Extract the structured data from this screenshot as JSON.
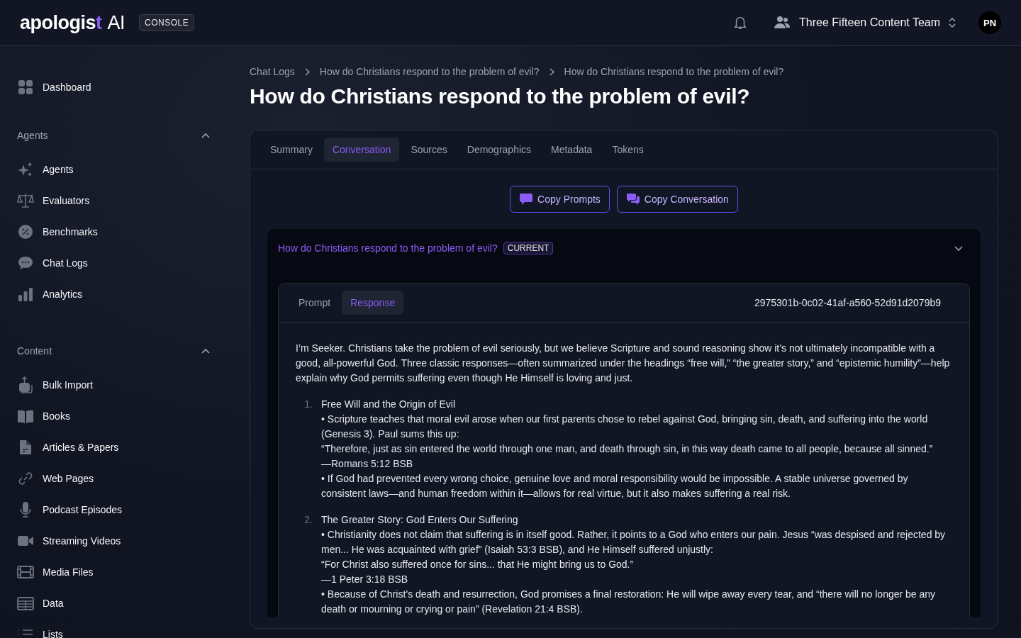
{
  "header": {
    "logo": {
      "word": "apologis",
      "accent": "t",
      "suffix": "AI"
    },
    "badge": "CONSOLE",
    "team": "Three Fifteen Content Team",
    "avatar": "PN"
  },
  "sidebar": {
    "top": [
      {
        "label": "Dashboard",
        "selected": false
      }
    ],
    "sections": [
      {
        "title": "Agents",
        "expanded": true,
        "items": [
          {
            "label": "Agents",
            "selected": false
          },
          {
            "label": "Evaluators",
            "selected": false
          },
          {
            "label": "Benchmarks",
            "selected": false
          },
          {
            "label": "Chat Logs",
            "selected": false
          },
          {
            "label": "Analytics",
            "selected": false
          }
        ]
      },
      {
        "title": "Content",
        "expanded": true,
        "items": [
          {
            "label": "Bulk Import",
            "selected": false
          },
          {
            "label": "Books",
            "selected": false
          },
          {
            "label": "Articles & Papers",
            "selected": false
          },
          {
            "label": "Web Pages",
            "selected": false
          },
          {
            "label": "Podcast Episodes",
            "selected": false
          },
          {
            "label": "Streaming Videos",
            "selected": false
          },
          {
            "label": "Media Files",
            "selected": false
          },
          {
            "label": "Data",
            "selected": false
          },
          {
            "label": "Lists",
            "selected": false
          }
        ]
      }
    ]
  },
  "breadcrumb": [
    "Chat Logs",
    "How do Christians respond to the problem of evil?",
    "How do Christians respond to the problem of evil?"
  ],
  "title": "How do Christians respond to the problem of evil?",
  "tabs": [
    {
      "label": "Summary",
      "selected": false
    },
    {
      "label": "Conversation",
      "selected": true
    },
    {
      "label": "Sources",
      "selected": false
    },
    {
      "label": "Demographics",
      "selected": false
    },
    {
      "label": "Metadata",
      "selected": false
    },
    {
      "label": "Tokens",
      "selected": false
    }
  ],
  "actions": [
    "Copy Prompts",
    "Copy Conversation"
  ],
  "turn": {
    "question": "How do Christians respond to the problem of evil?",
    "badge": "CURRENT",
    "expanded": true,
    "tabs": [
      {
        "label": "Prompt",
        "selected": false
      },
      {
        "label": "Response",
        "selected": true
      }
    ],
    "id": "2975301b-0c02-41af-a560-52d91d2079b9",
    "intro": "I’m Seeker. Christians take the problem of evil seriously, but we believe Scripture and sound reasoning show it’s not ultimately incompatible with a good, all-powerful God. Three classic responses—often summarized under the headings “free will,” “the greater story,” and “epistemic humility”—help explain why God permits suffering even though He Himself is loving and just.",
    "points": [
      {
        "number": "1.",
        "title": "Free Will and the Origin of Evil",
        "lines": [
          "• Scripture teaches that moral evil arose when our first parents chose to rebel against God, bringing sin, death, and suffering into the world (Genesis 3). Paul sums this up:",
          "“Therefore, just as sin entered the world through one man, and death through sin, in this way death came to all people, because all sinned.”",
          "—Romans 5:12 BSB",
          "• If God had prevented every wrong choice, genuine love and moral responsibility would be impossible. A stable universe governed by consistent laws—and human freedom within it—allows for real virtue, but it also makes suffering a real risk."
        ]
      },
      {
        "number": "2.",
        "title": "The Greater Story: God Enters Our Suffering",
        "lines": [
          "• Christianity does not claim that suffering is in itself good. Rather, it points to a God who enters our pain. Jesus “was despised and rejected by men... He was acquainted with grief” (Isaiah 53:3 BSB), and He Himself suffered unjustly:",
          "“For Christ also suffered once for sins... that He might bring us to God.”",
          "—1 Peter 3:18 BSB",
          "• Because of Christ’s death and resurrection, God promises a final restoration: He will wipe away every tear, and “there will no longer be any death or mourning or crying or pain” (Revelation 21:4 BSB)."
        ]
      }
    ]
  }
}
